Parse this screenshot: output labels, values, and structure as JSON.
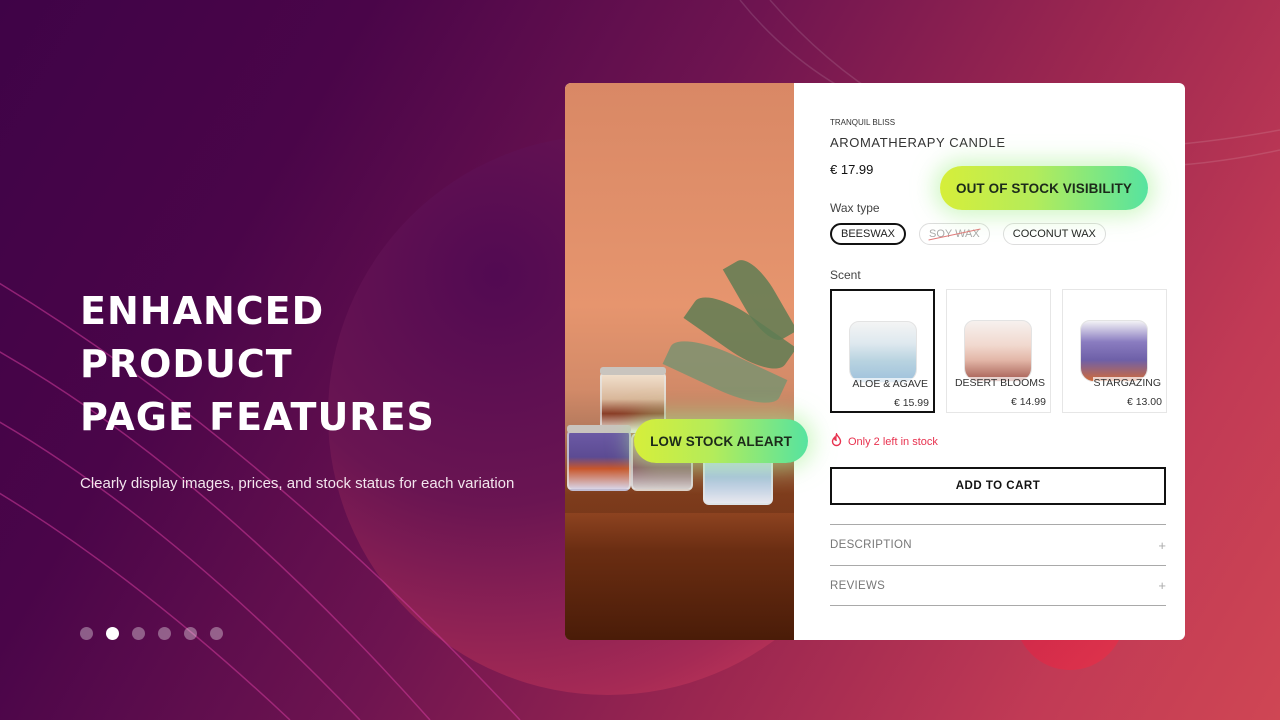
{
  "hero": {
    "title_line1": "ENHANCED PRODUCT",
    "title_line2": "PAGE FEATURES",
    "subtitle": "Clearly display images, prices, and stock status for each variation"
  },
  "carousel": {
    "total": 6,
    "active_index": 1
  },
  "product": {
    "brand": "TRANQUIL BLISS",
    "title": "AROMATHERAPY CANDLE",
    "price": "€ 17.99",
    "wax_label": "Wax type",
    "wax_options": [
      {
        "label": "BEESWAX",
        "state": "selected"
      },
      {
        "label": "SOY WAX",
        "state": "out-of-stock"
      },
      {
        "label": "COCONUT WAX",
        "state": "available"
      }
    ],
    "scent_label": "Scent",
    "scents": [
      {
        "name": "ALOE & AGAVE",
        "price": "€ 15.99",
        "selected": true
      },
      {
        "name": "DESERT BLOOMS",
        "price": "€ 14.99",
        "selected": false
      },
      {
        "name": "STARGAZING",
        "price": "€ 13.00",
        "selected": false
      }
    ],
    "stock_icon": "fire-icon",
    "stock_text": "Only 2 left in stock",
    "add_to_cart": "ADD TO CART",
    "accordions": [
      {
        "title": "DESCRIPTION",
        "icon": "plus-icon"
      },
      {
        "title": "REVIEWS",
        "icon": "plus-icon"
      }
    ]
  },
  "badges": {
    "out_of_stock": "OUT OF STOCK VISIBILITY",
    "low_stock": "LOW STOCK ALEART"
  },
  "colors": {
    "low_stock_red": "#e8324f",
    "badge_gradient_start": "#d6ee3a",
    "badge_gradient_end": "#56e3a0"
  }
}
